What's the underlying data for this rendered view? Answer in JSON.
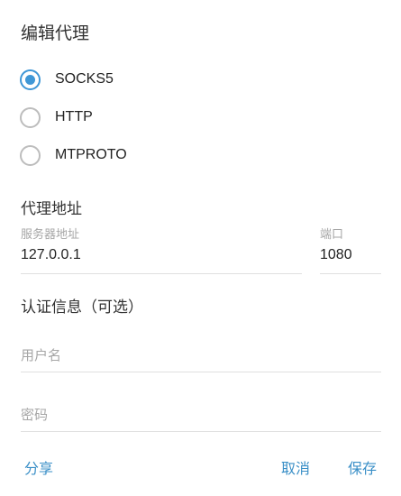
{
  "dialog": {
    "title": "编辑代理"
  },
  "proxy_types": [
    {
      "label": "SOCKS5",
      "selected": true
    },
    {
      "label": "HTTP",
      "selected": false
    },
    {
      "label": "MTPROTO",
      "selected": false
    }
  ],
  "address_section": {
    "title": "代理地址",
    "server": {
      "label": "服务器地址",
      "value": "127.0.0.1"
    },
    "port": {
      "label": "端口",
      "value": "1080"
    }
  },
  "auth_section": {
    "title": "认证信息（可选）",
    "username_placeholder": "用户名",
    "password_placeholder": "密码"
  },
  "actions": {
    "share": "分享",
    "cancel": "取消",
    "save": "保存"
  },
  "colors": {
    "accent": "#3f97d6",
    "link": "#3a8fc7"
  }
}
